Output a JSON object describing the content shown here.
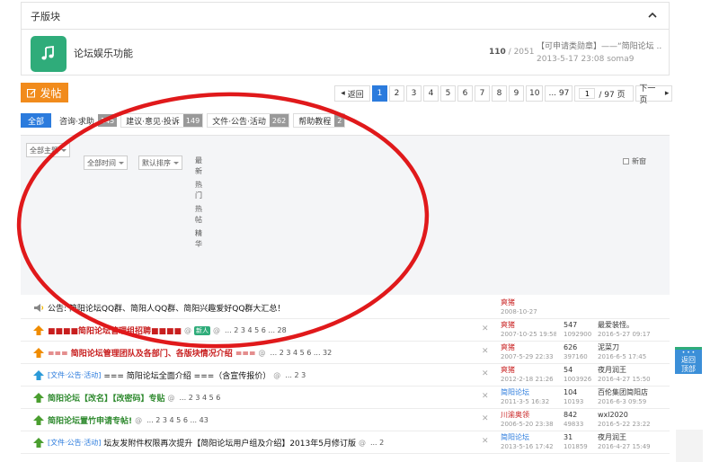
{
  "subboard": {
    "title": "子版块",
    "forum": {
      "name": "论坛娱乐功能",
      "threads": "110",
      "posts": "/ 2051",
      "last_title": "【可申请类勋章】——“简阳论坛 ...",
      "last_info": "2013-5-17 23:08 soma9"
    }
  },
  "post_button": "发帖",
  "pager": {
    "back": "返回",
    "pages": [
      "1",
      "2",
      "3",
      "4",
      "5",
      "6",
      "7",
      "8",
      "9",
      "10"
    ],
    "current": "1",
    "last": "... 97",
    "jump_value": "1",
    "total": "/ 97 页",
    "next": "下一页"
  },
  "tabs": [
    {
      "label": "全部",
      "count": ""
    },
    {
      "label": "咨询·求助",
      "count": "145"
    },
    {
      "label": "建议·意见·投诉",
      "count": "149"
    },
    {
      "label": "文件·公告·活动",
      "count": "262"
    },
    {
      "label": "帮助教程",
      "count": "2"
    }
  ],
  "filters": {
    "all_topics": "全部主题",
    "all_time": "全部时间",
    "default_sort": "默认排序",
    "latest": "最新",
    "hot": "热门",
    "hot_post": "热帖",
    "digest": "精华",
    "new_window": "新窗"
  },
  "threads": [
    {
      "type": "",
      "title": "公告: 简阳论坛QQ群、简阳人QQ群、简阳兴趣爱好QQ群大汇总！",
      "style": "black",
      "pages": "",
      "author": "爽猪",
      "author_style": "red",
      "date": "2008-10-27",
      "replies": "",
      "views": "",
      "last_user": "",
      "last_date": "",
      "icon": "speaker"
    },
    {
      "type": "",
      "title": "■■■■简阳论坛管理组招聘■■■■",
      "style": "red",
      "newtag": "新人",
      "pages": "... 2 3 4 5 6 ... 28",
      "author": "爽猪",
      "author_style": "red",
      "date": "2007-10-25 19:58",
      "replies": "547",
      "views": "1092900",
      "last_user": "最爱装怪。",
      "last_date": "2016-5-27 09:17",
      "icon": "up-orange"
    },
    {
      "type": "",
      "title": "=== 简阳论坛管理团队及各部门、各版块情况介绍 ===",
      "style": "red",
      "pages": "... 2 3 4 5 6 ... 32",
      "author": "爽猪",
      "author_style": "red",
      "date": "2007-5-29 22:33",
      "replies": "626",
      "views": "397160",
      "last_user": "泥菜刀",
      "last_date": "2016-6-5 17:45",
      "icon": "up-orange"
    },
    {
      "type": "[文件·公告·活动]",
      "title": "=== 简阳论坛全面介绍 ===（含宣传报价）",
      "style": "black",
      "pages": "... 2 3",
      "author": "爽猪",
      "author_style": "red",
      "date": "2012-2-18 21:26",
      "replies": "54",
      "views": "1003926",
      "last_user": "夜月润王",
      "last_date": "2016-4-27 15:50",
      "icon": "up-blue"
    },
    {
      "type": "",
      "title": "简阳论坛【改名】【改密码】专贴",
      "style": "green",
      "pages": "... 2 3 4 5 6",
      "author": "简阳论坛",
      "author_style": "blue",
      "date": "2011-3-5 16:32",
      "replies": "104",
      "views": "10193",
      "last_user": "百伦集团简阳店",
      "last_date": "2016-6-3 09:59",
      "icon": "up-green"
    },
    {
      "type": "",
      "title": "简阳论坛置竹申请专帖!",
      "style": "green",
      "pages": "... 2 3 4 5 6 ... 43",
      "author": "川渝奥领",
      "author_style": "red",
      "date": "2006-5-20 23:38",
      "replies": "842",
      "views": "49833",
      "last_user": "wxl2020",
      "last_date": "2016-5-22 23:22",
      "icon": "up-green"
    },
    {
      "type": "[文件·公告·活动]",
      "title": "坛友发附件权限再次提升【简阳论坛用户组及介绍】2013年5月修订版",
      "style": "black",
      "pages": "... 2",
      "author": "简阳论坛",
      "author_style": "blue",
      "date": "2013-5-16 17:42",
      "replies": "31",
      "views": "101859",
      "last_user": "夜月润王",
      "last_date": "2016-4-27 15:49",
      "icon": "up-green"
    }
  ],
  "float_widget": {
    "line1": "返回",
    "line2": "顶部"
  }
}
